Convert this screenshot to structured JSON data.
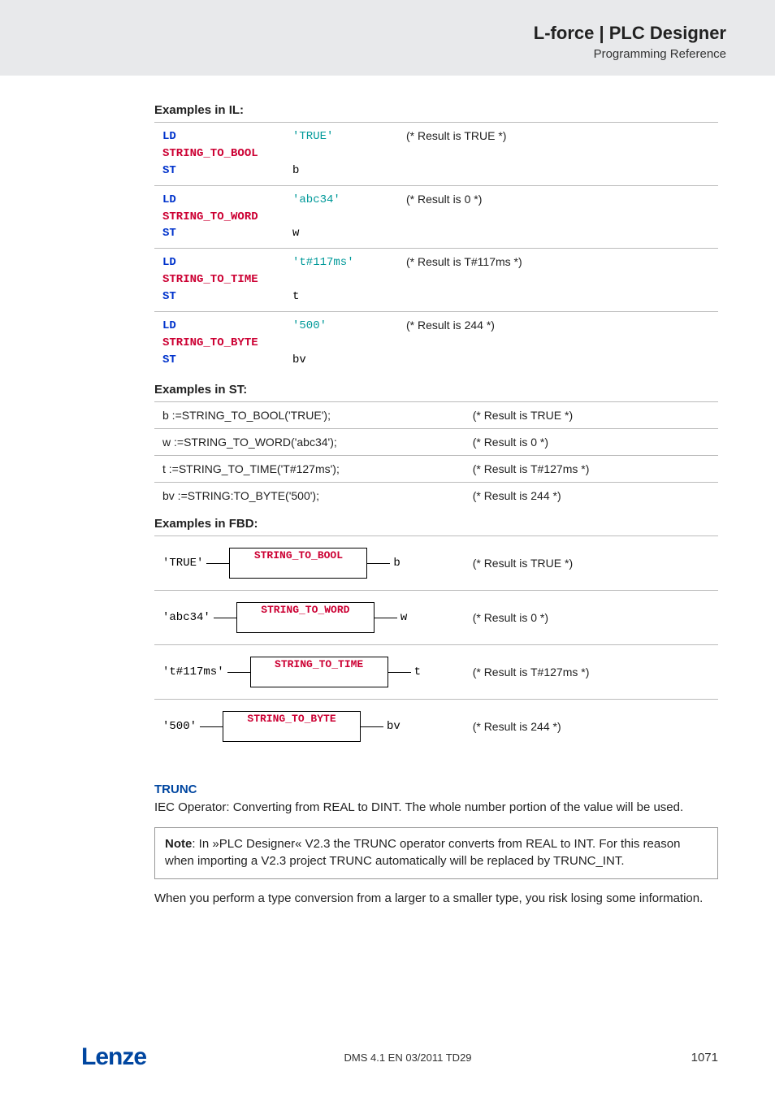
{
  "header": {
    "title": "L-force | PLC Designer",
    "subtitle": "Programming Reference"
  },
  "il": {
    "heading": "Examples in IL:",
    "rows": [
      {
        "code_lines": [
          {
            "kw": "LD"
          },
          {
            "conv": "STRING_TO_BOOL"
          },
          {
            "kw": "ST"
          }
        ],
        "op_lines": [
          "'TRUE'",
          "",
          "b"
        ],
        "op_class": [
          "lit",
          "",
          "plain"
        ],
        "result": "(* Result is TRUE *)"
      },
      {
        "code_lines": [
          {
            "kw": "LD"
          },
          {
            "conv": "STRING_TO_WORD"
          },
          {
            "kw": "ST"
          }
        ],
        "op_lines": [
          "'abc34'",
          "",
          "w"
        ],
        "op_class": [
          "lit",
          "",
          "plain"
        ],
        "result": "(* Result is 0 *)"
      },
      {
        "code_lines": [
          {
            "kw": "LD"
          },
          {
            "conv": "STRING_TO_TIME"
          },
          {
            "kw": "ST"
          }
        ],
        "op_lines": [
          "'t#117ms'",
          "",
          "t"
        ],
        "op_class": [
          "lit",
          "",
          "plain"
        ],
        "result": "(* Result is T#117ms *)"
      },
      {
        "code_lines": [
          {
            "kw": "LD"
          },
          {
            "conv": "STRING_TO_BYTE"
          },
          {
            "kw": "ST"
          }
        ],
        "op_lines": [
          "'500'",
          "",
          "bv"
        ],
        "op_class": [
          "lit",
          "",
          "plain"
        ],
        "result": "(* Result is 244 *)"
      }
    ]
  },
  "st": {
    "heading": "Examples in ST:",
    "rows": [
      {
        "code": "b :=STRING_TO_BOOL('TRUE');",
        "result": "(* Result is TRUE *)"
      },
      {
        "code": "w :=STRING_TO_WORD('abc34');",
        "result": "(* Result is 0 *)"
      },
      {
        "code": "t :=STRING_TO_TIME('T#127ms');",
        "result": "(* Result is T#127ms *)"
      },
      {
        "code": "bv :=STRING:TO_BYTE('500');",
        "result": "(* Result is 244 *)"
      }
    ]
  },
  "fbd": {
    "heading": "Examples in FBD:",
    "rows": [
      {
        "in": "'TRUE'",
        "block": "STRING_TO_BOOL",
        "out": "b",
        "result": "(* Result is TRUE *)"
      },
      {
        "in": "'abc34'",
        "block": "STRING_TO_WORD",
        "out": "w",
        "result": "(* Result is 0 *)"
      },
      {
        "in": "'t#117ms'",
        "block": "STRING_TO_TIME",
        "out": "t",
        "result": "(* Result is T#127ms *)"
      },
      {
        "in": "'500'",
        "block": "STRING_TO_BYTE",
        "out": "bv",
        "result": "(* Result is 244 *)"
      }
    ]
  },
  "trunc": {
    "heading": "TRUNC",
    "para1": "IEC Operator: Converting from REAL to DINT.  The whole number portion of the value will be used.",
    "note_bold": "Note",
    "note_body": ": In »PLC Designer« V2.3 the TRUNC operator converts from REAL to INT. For this reason when importing a V2.3 project TRUNC automatically will be replaced by TRUNC_INT.",
    "para2": "When you perform a type conversion from a larger to a smaller type, you risk losing some information."
  },
  "footer": {
    "logo": "Lenze",
    "center": "DMS 4.1 EN 03/2011 TD29",
    "page": "1071"
  }
}
